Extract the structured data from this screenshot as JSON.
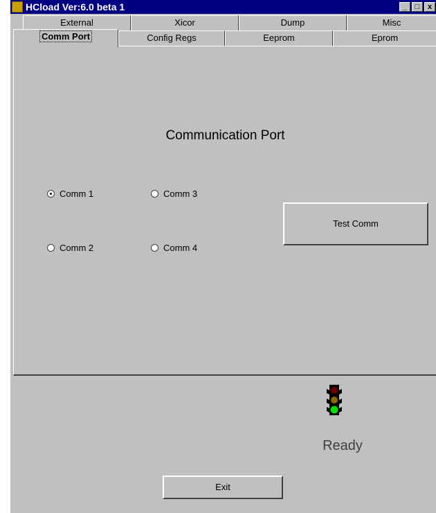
{
  "window": {
    "title": "HCload Ver:6.0 beta 1",
    "controls": [
      "_",
      "□",
      "x"
    ]
  },
  "tabs": {
    "back_row": [
      "External",
      "Xicor",
      "Dump",
      "Misc"
    ],
    "front_row": [
      "Comm Port",
      "Config Regs",
      "Eeprom",
      "Eprom"
    ],
    "active": "Comm Port"
  },
  "comm_panel": {
    "heading": "Communication Port",
    "ports": [
      {
        "label": "Comm 1",
        "selected": true
      },
      {
        "label": "Comm 3",
        "selected": false
      },
      {
        "label": "Comm 2",
        "selected": false
      },
      {
        "label": "Comm 4",
        "selected": false
      }
    ],
    "test_button": "Test Comm"
  },
  "status": {
    "text": "Ready",
    "light_colors": {
      "red": "#6a0000",
      "yellow": "#8a6a00",
      "green": "#00e000"
    }
  },
  "footer": {
    "exit_button": "Exit"
  }
}
